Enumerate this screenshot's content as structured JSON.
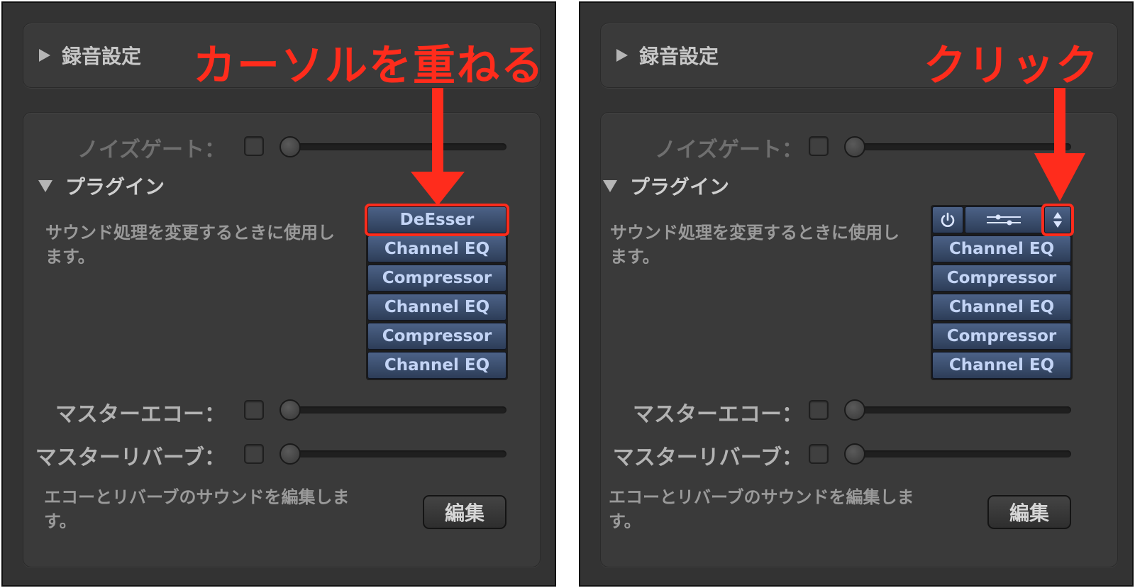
{
  "annotations": {
    "left": "カーソルを重ねる",
    "right": "クリック"
  },
  "recording": {
    "label": "録音設定"
  },
  "noise_gate": {
    "label": "ノイズゲート："
  },
  "plugins": {
    "title": "プラグイン",
    "description": "サウンド処理を変更するときに使用します。",
    "slots": [
      "DeEsser",
      "Channel EQ",
      "Compressor",
      "Channel EQ",
      "Compressor",
      "Channel EQ"
    ]
  },
  "master_echo": {
    "label": "マスターエコー："
  },
  "master_reverb": {
    "label": "マスターリバーブ："
  },
  "edit": {
    "description": "エコーとリバーブのサウンドを編集します。",
    "button": "編集"
  },
  "colors": {
    "annotation": "#ff2c1c",
    "panel": "#333333",
    "plugin_button": "#3b4f70",
    "plugin_text": "#c3d4f5"
  },
  "icons": {
    "power": "power-icon",
    "settings": "sliders-icon",
    "arrows": "up-down-arrows-icon"
  }
}
